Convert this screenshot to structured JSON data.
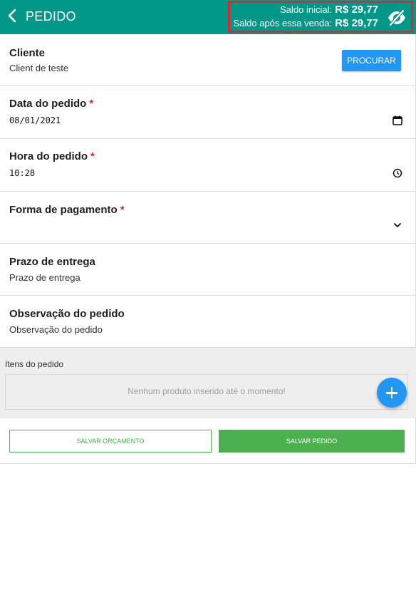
{
  "header": {
    "title": "PEDIDO",
    "back_icon": "chevron-left-icon",
    "saldo_inicial_label": "Saldo inicial:",
    "saldo_inicial_value": "R$ 29,77",
    "saldo_apos_label": "Saldo após essa venda:",
    "saldo_apos_value": "R$ 29,77",
    "visibility_icon": "eye-off-icon",
    "colors": {
      "bar": "#009688",
      "highlight_border": "#e3242b"
    }
  },
  "cliente": {
    "label": "Cliente",
    "value": "Client de teste",
    "button_label": "PROCURAR"
  },
  "data_pedido": {
    "label": "Data do pedido",
    "required_mark": "*",
    "value": "08/01/2021",
    "icon": "calendar-icon"
  },
  "hora_pedido": {
    "label": "Hora do pedido",
    "required_mark": "*",
    "value": "10:28",
    "icon": "clock-icon"
  },
  "forma_pagamento": {
    "label": "Forma de pagamento",
    "required_mark": "*",
    "value": "",
    "icon": "chevron-down-icon"
  },
  "prazo_entrega": {
    "label": "Prazo de entrega",
    "placeholder": "Prazo de entrega"
  },
  "observacao": {
    "label": "Observação do pedido",
    "placeholder": "Observação do pedido"
  },
  "itens": {
    "title": "Itens do pedido",
    "empty_message": "Nenhum produto inserido até o momento!",
    "add_icon": "plus-icon"
  },
  "actions": {
    "save_quote_label": "SALVAR ORÇAMENTO",
    "save_order_label": "SALVAR PEDIDO",
    "colors": {
      "primary": "#4caf50",
      "accent": "#2196f3"
    }
  }
}
